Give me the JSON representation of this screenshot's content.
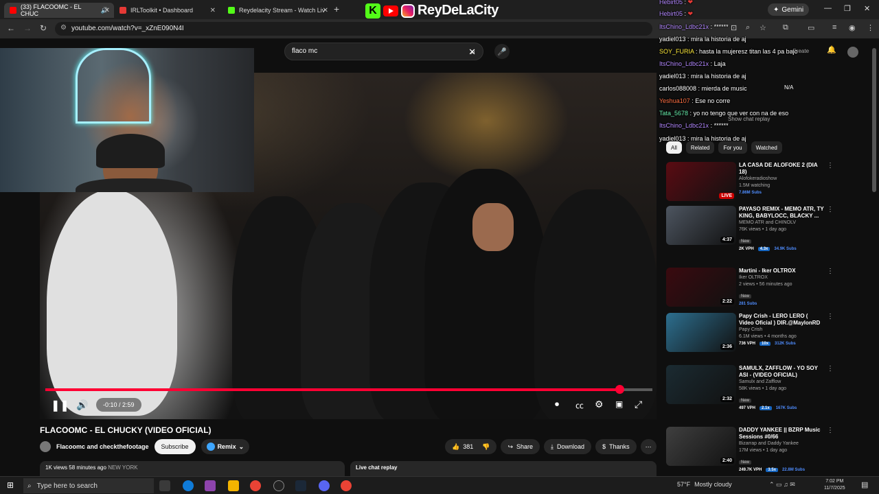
{
  "browser": {
    "tabs": [
      {
        "label": "(33) FLACOOMC - EL CHUC",
        "active": true,
        "color": "#ff0000"
      },
      {
        "label": "IRLToolkit • Dashboard",
        "active": false,
        "color": "#e53935"
      },
      {
        "label": "Reydelacity Stream - Watch Liv",
        "active": false,
        "color": "#53fc18"
      }
    ],
    "url": "youtube.com/watch?v=_xZnE090N4I",
    "gemini_label": "Gemini"
  },
  "brand": {
    "name": "ReyDeLaCity"
  },
  "youtube": {
    "search_value": "flaco mc",
    "player": {
      "time": "-0:10 / 2:59",
      "progress_fraction": 0.946
    },
    "title": "FLACOOMC - EL CHUCKY (VIDEO OFICIAL)",
    "owner": "Flacoomc and checkthefootage",
    "subscribe_label": "Subscribe",
    "remix_label": "Remix",
    "likes": "381",
    "share_label": "Share",
    "download_label": "Download",
    "thanks_label": "Thanks",
    "desc_views": "1K views",
    "desc_time": "58 minutes ago",
    "desc_loc": "NEW YORK",
    "live_chat_replay": "Live chat replay",
    "ghost": {
      "show_chat_replay": "Show chat replay",
      "na": "N/A",
      "create": "Create"
    },
    "chips": [
      "All",
      "Related",
      "For you",
      "Watched"
    ],
    "recommendations": [
      {
        "title": "LA CASA DE ALOFOKE 2 (DIA 18)",
        "channel": "Alofokeradioshow",
        "meta": "1.5M watching",
        "badge": "LIVE",
        "stats": [
          "",
          "",
          "7.86M Subs"
        ],
        "thumb": "#5a0b12"
      },
      {
        "title": "PAYASO REMIX - MEMO ATR, TY KING, BABYLOCC, BLACKY ...",
        "channel": "MEMO ATR and CHINOLV",
        "meta": "76K views • 1 day ago",
        "dur": "4:37",
        "new": "New",
        "stats": [
          "2K VPH",
          "4.3x",
          "34.9K Subs"
        ],
        "thumb": "#4d5560"
      },
      {
        "title": "Martini - Iker OLTROX",
        "channel": "Iker OLTROX",
        "meta": "2 views • 56 minutes ago",
        "dur": "2:22",
        "new": "New",
        "stats": [
          "",
          "",
          "281 Subs"
        ],
        "thumb": "#3a0a0f"
      },
      {
        "title": "Papy Crish - LERO LERO ( Video Oficial ) DIR.@MaylonRD",
        "channel": "Papy Crish",
        "meta": "6.1M views • 4 months ago",
        "dur": "2:36",
        "stats": [
          "736 VPH",
          "10x",
          "312K Subs"
        ],
        "thumb": "#2d6f8f"
      },
      {
        "title": "SAMULX, ZAFFLOW - YO SOY ASI - (VIDEO OFICIAL)",
        "channel": "Samulx and Zafflow",
        "meta": "58K views • 1 day ago",
        "dur": "2:32",
        "new": "New",
        "stats": [
          "497 VPH",
          "2.1x",
          "167K Subs"
        ],
        "thumb": "#1b2b32"
      },
      {
        "title": "DADDY YANKEE || BZRP Music Sessions #0/66",
        "channel": "Bizarrap and Daddy Yankee",
        "meta": "17M views • 1 day ago",
        "dur": "2:40",
        "new": "New",
        "stats": [
          "249.7K VPH",
          "3.5x",
          "22.8M Subs"
        ],
        "thumb": "#3f3f3f"
      }
    ]
  },
  "chat": [
    {
      "user": "Hebirt05",
      "msg": "❤",
      "color": "#b388ff"
    },
    {
      "user": "Hebirt05",
      "msg": "❤",
      "color": "#b388ff"
    },
    {
      "user": "ItsChino_Ldbc21x",
      "msg": "******",
      "color": "#b388ff"
    },
    {
      "user": "yadiel013",
      "msg": "mira la historia de aj",
      "color": "#ffffff"
    },
    {
      "user": "SOY_FURIA",
      "msg": "hasta la mujeresz titan las 4 pa bajo",
      "color": "#ffeb3b"
    },
    {
      "user": "ItsChino_Ldbc21x",
      "msg": "Laja",
      "color": "#b388ff"
    },
    {
      "user": "yadiel013",
      "msg": "mira la historia de aj",
      "color": "#ffffff"
    },
    {
      "user": "carlos088008",
      "msg": "mierda de music",
      "color": "#ffffff"
    },
    {
      "user": "Yeshua107",
      "msg": "Ese no corre",
      "color": "#ff7043"
    },
    {
      "user": "Tata_5678",
      "msg": "yo no tengo que ver con na de eso",
      "color": "#69f0ae"
    },
    {
      "user": "ItsChino_Ldbc21x",
      "msg": "******",
      "color": "#b388ff"
    },
    {
      "user": "yadiel013",
      "msg": "mira la historia de aj",
      "color": "#ffffff"
    }
  ],
  "taskbar": {
    "search_placeholder": "Type here to search",
    "temp": "57°F",
    "weather": "Mostly cloudy",
    "time": "7:02 PM",
    "date": "11/7/2025"
  }
}
